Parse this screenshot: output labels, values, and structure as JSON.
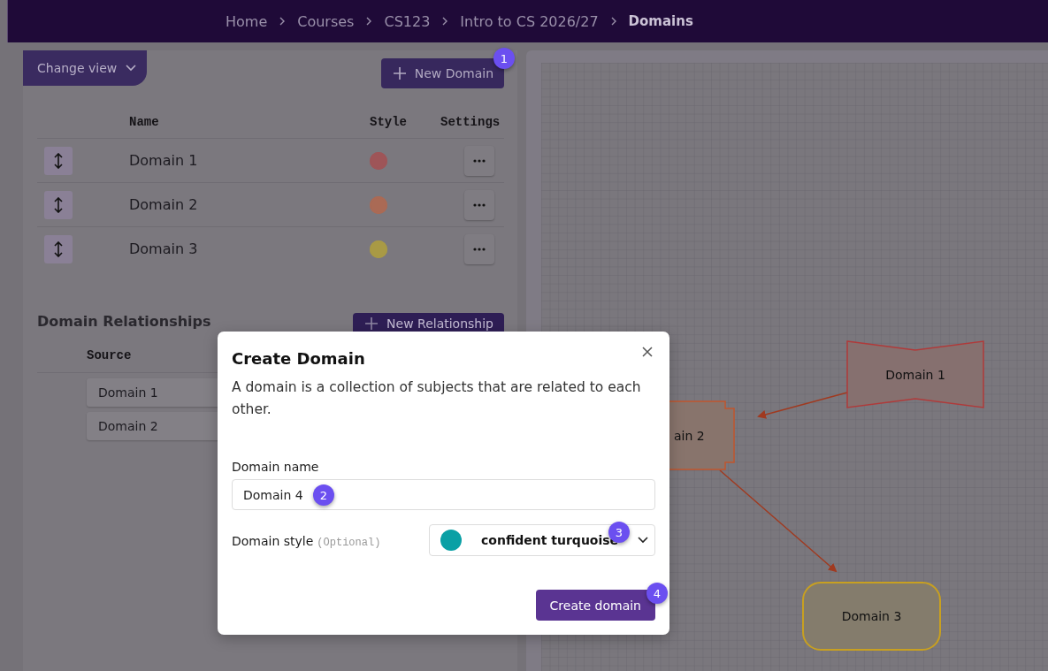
{
  "breadcrumb": [
    {
      "label": "Home",
      "current": false
    },
    {
      "label": "Courses",
      "current": false
    },
    {
      "label": "CS123",
      "current": false
    },
    {
      "label": "Intro to CS 2026/27",
      "current": false
    },
    {
      "label": "Domains",
      "current": true
    }
  ],
  "change_view": {
    "label": "Change view"
  },
  "new_domain_button": {
    "label": "New Domain",
    "badge": "1"
  },
  "domains_table": {
    "columns": [
      "Name",
      "Style",
      "Settings"
    ],
    "rows": [
      {
        "name": "Domain 1",
        "color": "#9e5558"
      },
      {
        "name": "Domain 2",
        "color": "#aa6a55"
      },
      {
        "name": "Domain 3",
        "color": "#a99a45"
      }
    ]
  },
  "relationships": {
    "title": "Domain Relationships",
    "new_button": {
      "label": "New Relationship"
    },
    "columns": [
      "Source"
    ],
    "rows": [
      {
        "source": "Domain 1"
      },
      {
        "source": "Domain 2"
      }
    ]
  },
  "canvas": {
    "nodes": [
      {
        "label": "Domain 1",
        "kind": "bowtie"
      },
      {
        "label": "ain 2",
        "kind": "notched"
      },
      {
        "label": "Domain 3",
        "kind": "rounded"
      }
    ]
  },
  "dialog": {
    "title": "Create Domain",
    "description": "A domain is a collection of subjects that are related to each other.",
    "name_label": "Domain name",
    "name_value": "Domain 4",
    "name_badge": "2",
    "style_label": "Domain style",
    "style_hint": "(Optional)",
    "style_value": "confident turquoise",
    "style_badge": "3",
    "create_button": {
      "label": "Create domain",
      "badge": "4"
    }
  }
}
